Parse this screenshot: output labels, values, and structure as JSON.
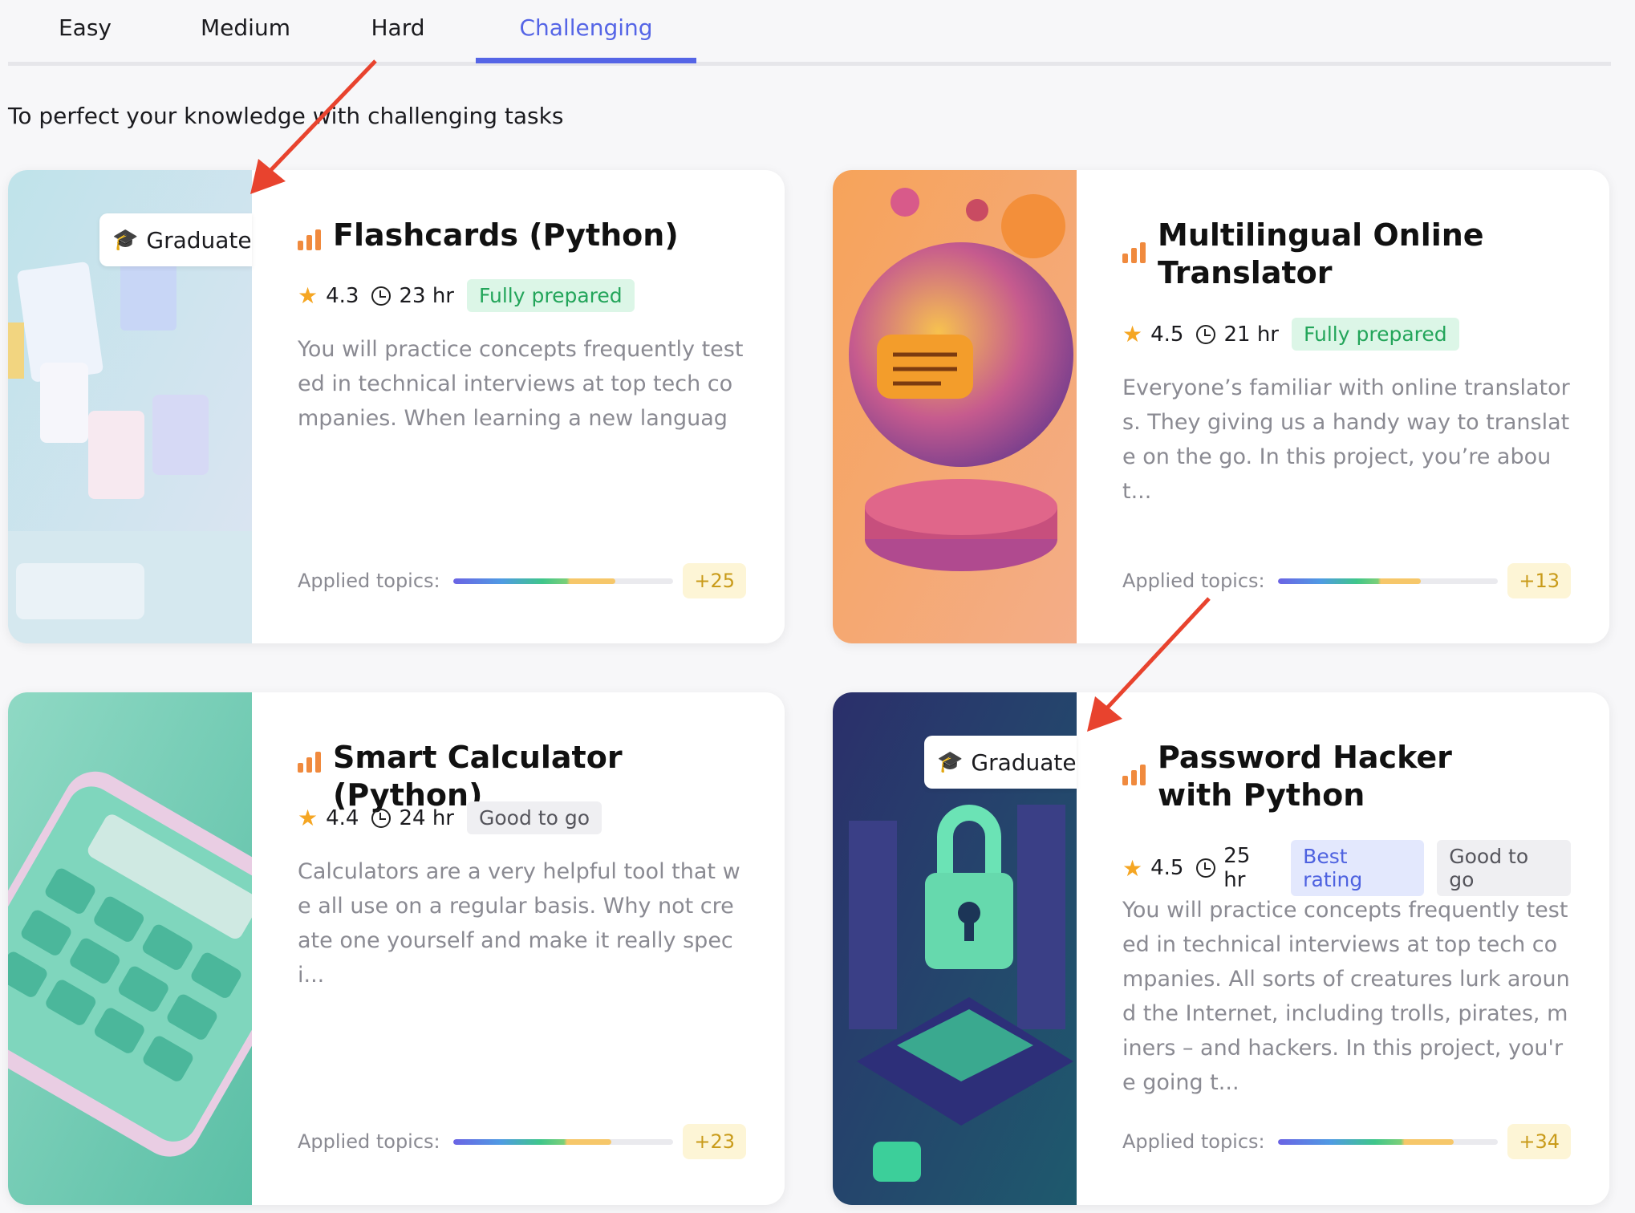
{
  "tabs": [
    {
      "label": "Easy",
      "active": false
    },
    {
      "label": "Medium",
      "active": false
    },
    {
      "label": "Hard",
      "active": false
    },
    {
      "label": "Challenging",
      "active": true
    }
  ],
  "subtitle": "To perfect your knowledge with challenging tasks",
  "accent_color": "#5565e6",
  "cards": [
    {
      "title": "Flashcards (Python)",
      "graduate_label": "Graduate",
      "rating": "4.3",
      "duration": "23 hr",
      "chips": [
        "Fully prepared"
      ],
      "description": "You will practice concepts frequently tested in technical interviews at top tech companies. When learning a new language, it can be hard to remember all the new vocabulary, which is exactly where flashcards can h...",
      "applied_label": "Applied topics:",
      "applied_progress": 0.74,
      "applied_more": "+25"
    },
    {
      "title": "Multilingual Online Translator",
      "rating": "4.5",
      "duration": "21 hr",
      "chips": [
        "Fully prepared"
      ],
      "description": "Everyone’s familiar with online translators. They giving us a handy way to translate on the go. In this project, you’re about...",
      "applied_label": "Applied topics:",
      "applied_progress": 0.65,
      "applied_more": "+13"
    },
    {
      "title": "Smart Calculator (Python)",
      "rating": "4.4",
      "duration": "24 hr",
      "chips": [
        "Good to go"
      ],
      "description": "Calculators are a very helpful tool that we all use on a regular basis. Why not create one yourself and make it really speci...",
      "applied_label": "Applied topics:",
      "applied_progress": 0.72,
      "applied_more": "+23"
    },
    {
      "title": "Password Hacker with Python",
      "graduate_label": "Graduate",
      "rating": "4.5",
      "duration": "25 hr",
      "chips": [
        "Best rating",
        "Good to go"
      ],
      "description": "You will practice concepts frequently tested in technical interviews at top tech companies. All sorts of creatures lurk around the Internet, including trolls, pirates, miners – and hackers. In this project, you're going t...",
      "applied_label": "Applied topics:",
      "applied_progress": 0.8,
      "applied_more": "+34"
    }
  ]
}
